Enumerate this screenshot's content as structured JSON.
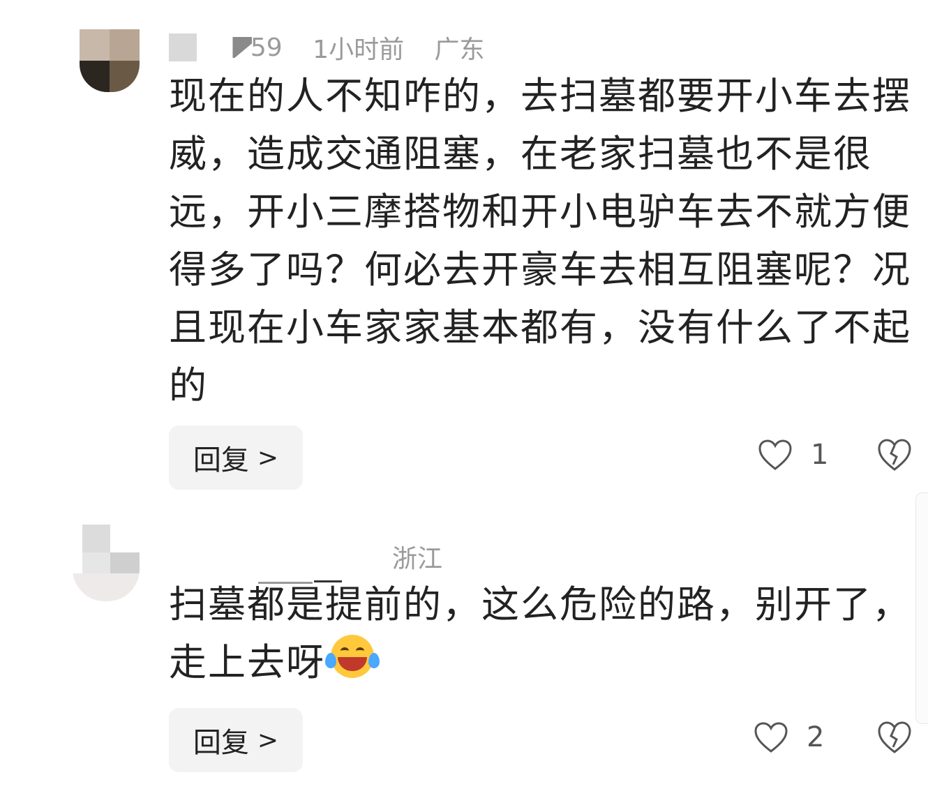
{
  "comments": [
    {
      "meta": {
        "likes_partial": "59",
        "time": "1小时前",
        "location": "广东"
      },
      "text_lines": [
        "现在的人不知咋的，去扫墓都要开小车去摆",
        "威，造成交通阻塞，在老家扫墓也不是很",
        "远，开小三摩搭物和开小电驴车去不就方便",
        "得多了吗？何必去开豪车去相互阻塞呢？况",
        "且现在小车家家基本都有，没有什么了不起",
        "的"
      ],
      "reply_label": "回复",
      "like_count": "1"
    },
    {
      "meta": {
        "location": "浙江"
      },
      "text_lines": [
        "扫墓都是提前的，这么危险的路，别开了，",
        "走上去呀"
      ],
      "emoji": "laughing-crying-emoji",
      "reply_label": "回复",
      "like_count": "2"
    }
  ],
  "colors": {
    "meta": "#9a9a9a",
    "body": "#222222",
    "button_bg": "#f3f3f3",
    "accent": "#ffc83d"
  }
}
